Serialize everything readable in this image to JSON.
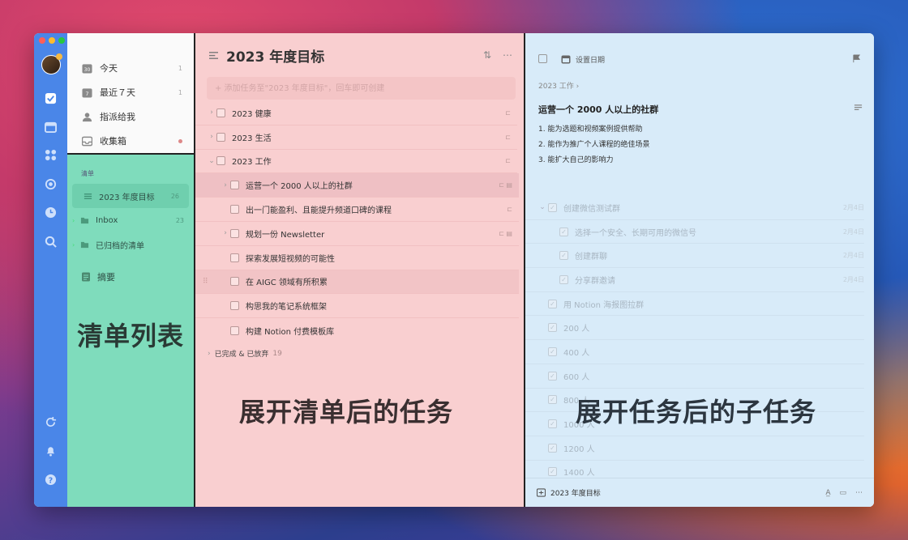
{
  "smart_lists": [
    {
      "label": "今天",
      "count": "1",
      "badge": "30"
    },
    {
      "label": "最近７天",
      "count": "1"
    },
    {
      "label": "指派给我",
      "count": ""
    },
    {
      "label": "收集箱",
      "count": ""
    }
  ],
  "lists_section_title": "清单",
  "lists": [
    {
      "label": "2023 年度目标",
      "count": "26"
    },
    {
      "label": "Inbox",
      "count": "23"
    },
    {
      "label": "已归档的清单",
      "count": ""
    }
  ],
  "digest_label": "摘要",
  "lists_annotation": "清单列表",
  "task_panel": {
    "title": "2023 年度目标",
    "add_placeholder": "+ 添加任务至\"2023 年度目标\"，回车即可创建",
    "groups": [
      {
        "label": "2023 健康"
      },
      {
        "label": "2023 生活"
      },
      {
        "label": "2023 工作"
      }
    ],
    "subtasks": [
      {
        "label": "运营一个 2000 人以上的社群"
      },
      {
        "label": "出一门能盈利、且能提升频道口碑的课程"
      },
      {
        "label": "规划一份 Newsletter"
      },
      {
        "label": "探索发展短视频的可能性"
      },
      {
        "label": "在 AIGC 领域有所积累"
      },
      {
        "label": "构思我的笔记系统框架"
      },
      {
        "label": "构建 Notion 付费模板库"
      }
    ],
    "completed_label": "已完成 & 已放弃",
    "completed_count": "19",
    "annotation": "展开清单后的任务"
  },
  "detail_panel": {
    "date_label": "设置日期",
    "breadcrumb": "2023 工作 ›",
    "title": "运营一个 2000 人以上的社群",
    "notes": [
      "1. 能为选题和视频案例提供帮助",
      "2. 能作为推广个人课程的绝佳场景",
      "3. 能扩大自己的影响力"
    ],
    "subtasks": [
      {
        "label": "创建微信测试群",
        "date": "2月4日",
        "level": "top",
        "expand": true
      },
      {
        "label": "选择一个安全、长期可用的微信号",
        "date": "2月4日",
        "level": "child"
      },
      {
        "label": "创建群聊",
        "date": "2月4日",
        "level": "child"
      },
      {
        "label": "分享群邀请",
        "date": "2月4日",
        "level": "child"
      },
      {
        "label": "用 Notion 海报图拉群",
        "date": "",
        "level": "top"
      },
      {
        "label": "200 人",
        "date": "",
        "level": "top"
      },
      {
        "label": "400 人",
        "date": "",
        "level": "top"
      },
      {
        "label": "600 人",
        "date": "",
        "level": "top"
      },
      {
        "label": "800 人",
        "date": "",
        "level": "top"
      },
      {
        "label": "1000 人",
        "date": "",
        "level": "top"
      },
      {
        "label": "1200 人",
        "date": "",
        "level": "top"
      },
      {
        "label": "1400 人",
        "date": "",
        "level": "top"
      }
    ],
    "footer_list": "2023 年度目标",
    "annotation": "展开任务后的子任务"
  }
}
